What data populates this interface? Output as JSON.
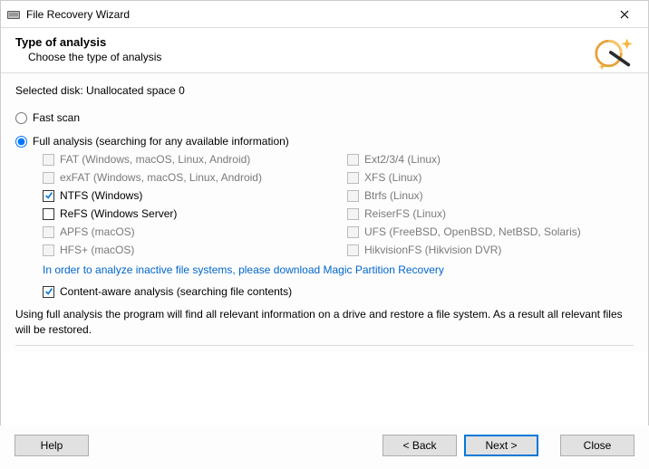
{
  "window": {
    "title": "File Recovery Wizard"
  },
  "header": {
    "title": "Type of analysis",
    "subtitle": "Choose the type of analysis"
  },
  "selected_disk_label": "Selected disk: Unallocated space 0",
  "radios": {
    "fast": {
      "label": "Fast scan",
      "checked": false
    },
    "full": {
      "label": "Full analysis (searching for any available information)",
      "checked": true
    }
  },
  "filesystems": [
    {
      "label": "FAT (Windows, macOS, Linux, Android)",
      "checked": false,
      "enabled": false
    },
    {
      "label": "Ext2/3/4 (Linux)",
      "checked": false,
      "enabled": false
    },
    {
      "label": "exFAT (Windows, macOS, Linux, Android)",
      "checked": false,
      "enabled": false
    },
    {
      "label": "XFS (Linux)",
      "checked": false,
      "enabled": false
    },
    {
      "label": "NTFS (Windows)",
      "checked": true,
      "enabled": true
    },
    {
      "label": "Btrfs (Linux)",
      "checked": false,
      "enabled": false
    },
    {
      "label": "ReFS (Windows Server)",
      "checked": false,
      "enabled": true
    },
    {
      "label": "ReiserFS (Linux)",
      "checked": false,
      "enabled": false
    },
    {
      "label": "APFS (macOS)",
      "checked": false,
      "enabled": false
    },
    {
      "label": "UFS (FreeBSD, OpenBSD, NetBSD, Solaris)",
      "checked": false,
      "enabled": false
    },
    {
      "label": "HFS+ (macOS)",
      "checked": false,
      "enabled": false
    },
    {
      "label": "HikvisionFS (Hikvision DVR)",
      "checked": false,
      "enabled": false
    }
  ],
  "download_link": "In order to analyze inactive file systems, please download Magic Partition Recovery",
  "content_aware": {
    "label": "Content-aware analysis (searching file contents)",
    "checked": true
  },
  "explain": "Using full analysis the program will find all relevant information on a drive and restore a file system. As a result all relevant files will be restored.",
  "buttons": {
    "help": "Help",
    "back": "< Back",
    "next": "Next >",
    "close": "Close"
  }
}
